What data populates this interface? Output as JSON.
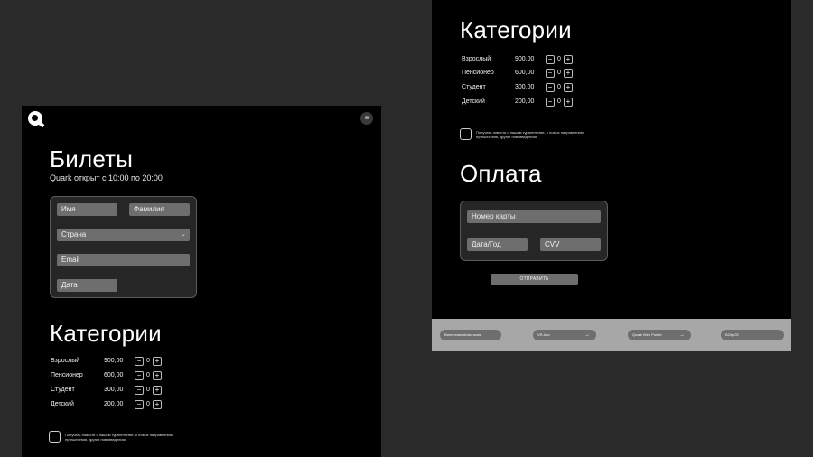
{
  "left_panel": {
    "title": "Билеты",
    "subtitle": "Quark открыт с 10:00 по 20:00",
    "menu_icon": "≡",
    "form": {
      "first_name": "Имя",
      "last_name": "Фамилия",
      "country": "Страна",
      "country_chevron": "⌄",
      "email": "Email",
      "date": "Дата"
    },
    "categories_title": "Категории",
    "categories": [
      {
        "name": "Взрослый",
        "price": "900,00",
        "qty": "0"
      },
      {
        "name": "Пенсионер",
        "price": "600,00",
        "qty": "0"
      },
      {
        "name": "Студент",
        "price": "300,00",
        "qty": "0"
      },
      {
        "name": "Детский",
        "price": "200,00",
        "qty": "0"
      }
    ],
    "newsletter": "Получать новости о нашем турагентстве, о новых направлениях путешествия, других нововведениях"
  },
  "right_panel": {
    "categories_title": "Категории",
    "categories": [
      {
        "name": "Взрослый",
        "price": "900,00",
        "qty": "0"
      },
      {
        "name": "Пенсионер",
        "price": "600,00",
        "qty": "0"
      },
      {
        "name": "Студент",
        "price": "300,00",
        "qty": "0"
      },
      {
        "name": "Детский",
        "price": "200,00",
        "qty": "0"
      }
    ],
    "newsletter": "Получать новости о нашем турагентстве, о новых направлениях путешествия, других нововведениях",
    "payment_title": "Оплата",
    "payment": {
      "card_number": "Номер карты",
      "expiry": "Дата/Год",
      "cvv": "CVV"
    },
    "submit": "ОТПРАВИТЬ"
  },
  "stepper": {
    "minus": "−",
    "plus": "+"
  },
  "footer": {
    "items": [
      {
        "label": "Виноглова Анастасия"
      },
      {
        "label": "VR-tour",
        "arrow": "→"
      },
      {
        "label": "Quark Web Poster",
        "arrow": "→"
      },
      {
        "label": "B24pj00"
      }
    ]
  }
}
